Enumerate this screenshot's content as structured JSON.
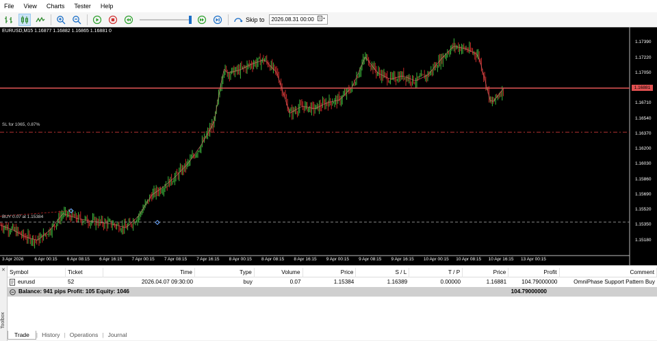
{
  "menu": [
    "File",
    "View",
    "Charts",
    "Tester",
    "Help"
  ],
  "toolbar": {
    "icons": [
      "new-order-icon",
      "candles-icon",
      "line-chart-icon",
      "zoom-in-icon",
      "zoom-out-icon",
      "play-icon",
      "stop-icon",
      "rewind-icon",
      "fast-forward-icon",
      "skip-end-icon",
      "skip-to-icon"
    ],
    "skip_label": "Skip to",
    "skip_value": "2026.08.31 00:00"
  },
  "chart": {
    "title": "EURUSD,M15  1.16877  1.16882  1.16865  1.16881  0",
    "sl_label": "SL for 1065, 0.87%",
    "buy_label": "BUY 0.07 at 1.15384",
    "current_price": "1.16881",
    "colors": {
      "background": "#000000",
      "bull": "#3cb83c",
      "bear": "#c82828",
      "price_line": "#d45050",
      "level_line": "#b03030",
      "ma": "#e07070"
    }
  },
  "chart_data": {
    "type": "line",
    "y_ticks": [
      "1.17390",
      "1.17220",
      "1.17050",
      "1.16881",
      "1.16710",
      "1.16540",
      "1.16370",
      "1.16200",
      "1.16030",
      "1.15860",
      "1.15690",
      "1.15520",
      "1.15350",
      "1.15180"
    ],
    "ylim": [
      1.1501,
      1.1756
    ],
    "x_labels": [
      "3 Apr 2026",
      "6 Apr 00:15",
      "6 Apr 08:15",
      "6 Apr 16:15",
      "7 Apr 00:15",
      "7 Apr 08:15",
      "7 Apr 16:15",
      "8 Apr 00:15",
      "8 Apr 08:15",
      "8 Apr 16:15",
      "9 Apr 00:15",
      "9 Apr 08:15",
      "9 Apr 16:15",
      "10 Apr 00:15",
      "10 Apr 08:15",
      "10 Apr 16:15",
      "13 Apr 00:15"
    ],
    "x": [
      0,
      0.02,
      0.04,
      0.06,
      0.08,
      0.1,
      0.12,
      0.14,
      0.16,
      0.18,
      0.2,
      0.22,
      0.24,
      0.26,
      0.28,
      0.3,
      0.32,
      0.34,
      0.35,
      0.355,
      0.36,
      0.38,
      0.4,
      0.42,
      0.44,
      0.46,
      0.48,
      0.5,
      0.52,
      0.54,
      0.56,
      0.58,
      0.6,
      0.62,
      0.64,
      0.66,
      0.68,
      0.7,
      0.72,
      0.74,
      0.76,
      0.78,
      0.8,
      0.8
    ],
    "y": [
      1.1535,
      1.153,
      1.1522,
      1.1518,
      1.153,
      1.1548,
      1.1543,
      1.154,
      1.1538,
      1.1536,
      1.1532,
      1.1545,
      1.1568,
      1.1578,
      1.159,
      1.1605,
      1.1625,
      1.165,
      1.169,
      1.171,
      1.1705,
      1.1708,
      1.1715,
      1.172,
      1.1705,
      1.166,
      1.1668,
      1.1665,
      1.1672,
      1.1675,
      1.169,
      1.1723,
      1.1705,
      1.1698,
      1.1702,
      1.1696,
      1.1703,
      1.172,
      1.1735,
      1.1732,
      1.1725,
      1.167,
      1.1688,
      1.1688
    ],
    "levels": {
      "current": 1.16881,
      "stop_loss": 1.16389,
      "buy": 1.15384
    }
  },
  "terminal": {
    "side_label": "Toolbox",
    "columns": [
      "Symbol",
      "Ticket",
      "Time",
      "Type",
      "Volume",
      "Price",
      "S / L",
      "T / P",
      "Price",
      "Profit",
      "Comment"
    ],
    "rows": [
      [
        "eurusd",
        "52",
        "2026.04.07 09:30:00",
        "buy",
        "0.07",
        "1.15384",
        "1.16389",
        "0.00000",
        "1.16881",
        "104.79000000",
        "OmniPhase Support Pattern Buy"
      ]
    ],
    "balance_text": "Balance: 941 pips   Profit: 105   Equity: 1046",
    "balance_profit": "104.79000000",
    "tabs": [
      "Trade",
      "History",
      "Operations",
      "Journal"
    ]
  }
}
